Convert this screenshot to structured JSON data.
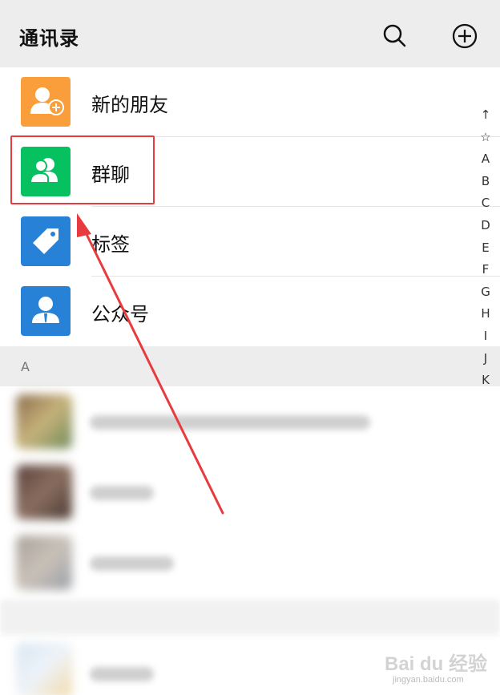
{
  "header": {
    "title": "通讯录",
    "search_icon": "search-icon",
    "add_icon": "add-circle-icon"
  },
  "menu_items": [
    {
      "label": "新的朋友",
      "icon": "add-friend-icon",
      "color": "#fa9d3b"
    },
    {
      "label": "群聊",
      "icon": "group-chat-icon",
      "color": "#07c160"
    },
    {
      "label": "标签",
      "icon": "tag-icon",
      "color": "#2782d7"
    },
    {
      "label": "公众号",
      "icon": "official-account-icon",
      "color": "#2782d7"
    }
  ],
  "section": {
    "label": "A"
  },
  "index_bar": [
    "↑",
    "☆",
    "A",
    "B",
    "C",
    "D",
    "E",
    "F",
    "G",
    "H",
    "I",
    "J",
    "K"
  ],
  "annotation": {
    "highlight_color": "#e83b3f",
    "highlighted_item": "群聊"
  },
  "watermark": {
    "main": "Bai du 经验",
    "sub": "jingyan.baidu.com"
  }
}
